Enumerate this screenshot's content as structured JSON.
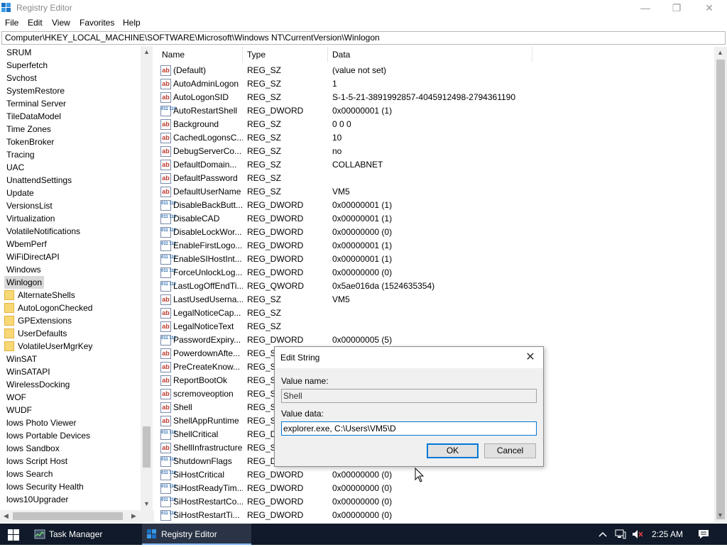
{
  "window": {
    "title": "Registry Editor",
    "controls": {
      "minimize": "—",
      "maximize": "❐",
      "close": "✕"
    }
  },
  "menu": [
    "File",
    "Edit",
    "View",
    "Favorites",
    "Help"
  ],
  "address": "Computer\\HKEY_LOCAL_MACHINE\\SOFTWARE\\Microsoft\\Windows NT\\CurrentVersion\\Winlogon",
  "tree": {
    "items": [
      "SRUM",
      "Superfetch",
      "Svchost",
      "SystemRestore",
      "Terminal Server",
      "TileDataModel",
      "Time Zones",
      "TokenBroker",
      "Tracing",
      "UAC",
      "UnattendSettings",
      "Update",
      "VersionsList",
      "Virtualization",
      "VolatileNotifications",
      "WbemPerf",
      "WiFiDirectAPI",
      "Windows",
      "Winlogon",
      "AlternateShells",
      "AutoLogonChecked",
      "GPExtensions",
      "UserDefaults",
      "VolatileUserMgrKey",
      "WinSAT",
      "WinSATAPI",
      "WirelessDocking",
      "WOF",
      "WUDF",
      "lows Photo Viewer",
      "lows Portable Devices",
      "lows Sandbox",
      "lows Script Host",
      "lows Search",
      "lows Security Health",
      "lows10Upgrader"
    ],
    "selected": "Winlogon"
  },
  "columns": {
    "name": "Name",
    "type": "Type",
    "data": "Data"
  },
  "values": [
    {
      "name": "(Default)",
      "type": "REG_SZ",
      "data": "(value not set)",
      "icon": "string-value-icon"
    },
    {
      "name": "AutoAdminLogon",
      "type": "REG_SZ",
      "data": "1",
      "icon": "string-value-icon"
    },
    {
      "name": "AutoLogonSID",
      "type": "REG_SZ",
      "data": "S-1-5-21-3891992857-4045912498-2794361190",
      "icon": "string-value-icon"
    },
    {
      "name": "AutoRestartShell",
      "type": "REG_DWORD",
      "data": "0x00000001 (1)",
      "icon": "binary-value-icon"
    },
    {
      "name": "Background",
      "type": "REG_SZ",
      "data": "0 0 0",
      "icon": "string-value-icon"
    },
    {
      "name": "CachedLogonsC...",
      "type": "REG_SZ",
      "data": "10",
      "icon": "string-value-icon"
    },
    {
      "name": "DebugServerCo...",
      "type": "REG_SZ",
      "data": "no",
      "icon": "string-value-icon"
    },
    {
      "name": "DefaultDomain...",
      "type": "REG_SZ",
      "data": "COLLABNET",
      "icon": "string-value-icon"
    },
    {
      "name": "DefaultPassword",
      "type": "REG_SZ",
      "data": "",
      "icon": "string-value-icon"
    },
    {
      "name": "DefaultUserName",
      "type": "REG_SZ",
      "data": "VM5",
      "icon": "string-value-icon"
    },
    {
      "name": "DisableBackButt...",
      "type": "REG_DWORD",
      "data": "0x00000001 (1)",
      "icon": "binary-value-icon"
    },
    {
      "name": "DisableCAD",
      "type": "REG_DWORD",
      "data": "0x00000001 (1)",
      "icon": "binary-value-icon"
    },
    {
      "name": "DisableLockWor...",
      "type": "REG_DWORD",
      "data": "0x00000000 (0)",
      "icon": "binary-value-icon"
    },
    {
      "name": "EnableFirstLogo...",
      "type": "REG_DWORD",
      "data": "0x00000001 (1)",
      "icon": "binary-value-icon"
    },
    {
      "name": "EnableSIHostInt...",
      "type": "REG_DWORD",
      "data": "0x00000001 (1)",
      "icon": "binary-value-icon"
    },
    {
      "name": "ForceUnlockLog...",
      "type": "REG_DWORD",
      "data": "0x00000000 (0)",
      "icon": "binary-value-icon"
    },
    {
      "name": "LastLogOffEndTi...",
      "type": "REG_QWORD",
      "data": "0x5ae016da (1524635354)",
      "icon": "binary-value-icon"
    },
    {
      "name": "LastUsedUserna...",
      "type": "REG_SZ",
      "data": "VM5",
      "icon": "string-value-icon"
    },
    {
      "name": "LegalNoticeCap...",
      "type": "REG_SZ",
      "data": "",
      "icon": "string-value-icon"
    },
    {
      "name": "LegalNoticeText",
      "type": "REG_SZ",
      "data": "",
      "icon": "string-value-icon"
    },
    {
      "name": "PasswordExpiry...",
      "type": "REG_DWORD",
      "data": "0x00000005 (5)",
      "icon": "binary-value-icon"
    },
    {
      "name": "PowerdownAfte...",
      "type": "REG_SZ",
      "data": "",
      "icon": "string-value-icon"
    },
    {
      "name": "PreCreateKnow...",
      "type": "REG_SZ",
      "data": "",
      "icon": "string-value-icon"
    },
    {
      "name": "ReportBootOk",
      "type": "REG_SZ",
      "data": "",
      "icon": "string-value-icon"
    },
    {
      "name": "scremoveoption",
      "type": "REG_SZ",
      "data": "",
      "icon": "string-value-icon"
    },
    {
      "name": "Shell",
      "type": "REG_SZ",
      "data": "",
      "icon": "string-value-icon"
    },
    {
      "name": "ShellAppRuntime",
      "type": "REG_SZ",
      "data": "",
      "icon": "string-value-icon"
    },
    {
      "name": "ShellCritical",
      "type": "REG_DW",
      "data": "",
      "icon": "binary-value-icon"
    },
    {
      "name": "ShellInfrastructure",
      "type": "REG_SZ",
      "data": "",
      "icon": "string-value-icon"
    },
    {
      "name": "ShutdownFlags",
      "type": "REG_DW",
      "data": "",
      "icon": "binary-value-icon"
    },
    {
      "name": "SiHostCritical",
      "type": "REG_DWORD",
      "data": "0x00000000 (0)",
      "icon": "binary-value-icon"
    },
    {
      "name": "SiHostReadyTim...",
      "type": "REG_DWORD",
      "data": "0x00000000 (0)",
      "icon": "binary-value-icon"
    },
    {
      "name": "SiHostRestartCo...",
      "type": "REG_DWORD",
      "data": "0x00000000 (0)",
      "icon": "binary-value-icon"
    },
    {
      "name": "SiHostRestartTi...",
      "type": "REG_DWORD",
      "data": "0x00000000 (0)",
      "icon": "binary-value-icon"
    }
  ],
  "dialog": {
    "title": "Edit String",
    "close": "✕",
    "value_name_label": "Value name:",
    "value_name": "Shell",
    "value_data_label": "Value data:",
    "value_data": "explorer.exe, C:\\Users\\VM5\\D",
    "ok": "OK",
    "cancel": "Cancel"
  },
  "taskbar": {
    "items": [
      {
        "label": "Task Manager",
        "icon": "task-manager-icon",
        "active": false
      },
      {
        "label": "Registry Editor",
        "icon": "registry-editor-icon",
        "active": true
      }
    ],
    "time": "2:25 AM"
  },
  "colors": {
    "accent": "#0078d7",
    "taskbar": "#101a2a",
    "selection": "#d9d9d9",
    "folder": "#f8d775"
  }
}
